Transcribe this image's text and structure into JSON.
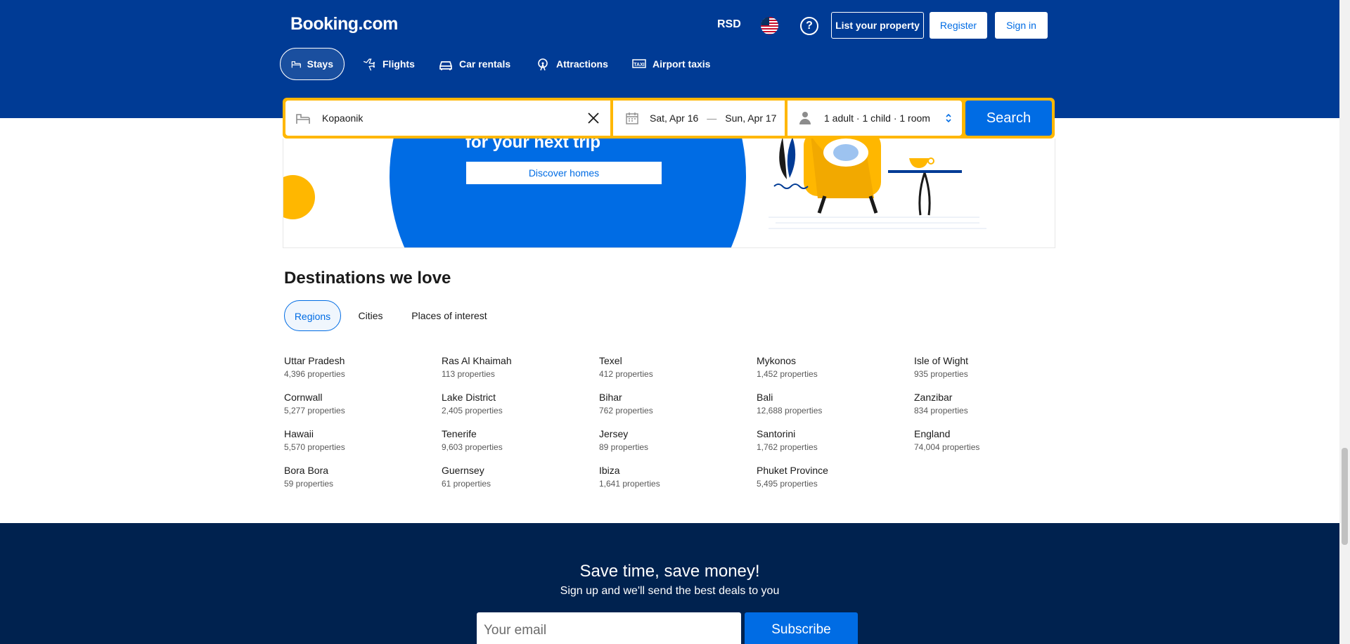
{
  "header": {
    "logo": "Booking.com",
    "currency": "RSD",
    "help_icon": "?",
    "list_property": "List your property",
    "register": "Register",
    "sign_in": "Sign in"
  },
  "nav": [
    {
      "label": "Stays",
      "icon": "bed-icon",
      "active": true
    },
    {
      "label": "Flights",
      "icon": "plane-icon"
    },
    {
      "label": "Car rentals",
      "icon": "car-icon"
    },
    {
      "label": "Attractions",
      "icon": "ferris-wheel-icon"
    },
    {
      "label": "Airport taxis",
      "icon": "taxi-icon"
    }
  ],
  "search": {
    "destination": "Kopaonik",
    "checkin": "Sat, Apr 16",
    "date_separator": "—",
    "checkout": "Sun, Apr 17",
    "guests": "1 adult · 1 child · 1 room",
    "button": "Search"
  },
  "banner": {
    "heading": "for your next trip",
    "button": "Discover homes"
  },
  "destinations": {
    "title": "Destinations we love",
    "tabs": [
      "Regions",
      "Cities",
      "Places of interest"
    ],
    "active_tab": "Regions",
    "columns": [
      [
        {
          "name": "Uttar Pradesh",
          "count": "4,396 properties"
        },
        {
          "name": "Cornwall",
          "count": "5,277 properties"
        },
        {
          "name": "Hawaii",
          "count": "5,570 properties"
        },
        {
          "name": "Bora Bora",
          "count": "59 properties"
        }
      ],
      [
        {
          "name": "Ras Al Khaimah",
          "count": "113 properties"
        },
        {
          "name": "Lake District",
          "count": "2,405 properties"
        },
        {
          "name": "Tenerife",
          "count": "9,603 properties"
        },
        {
          "name": "Guernsey",
          "count": "61 properties"
        }
      ],
      [
        {
          "name": "Texel",
          "count": "412 properties"
        },
        {
          "name": "Bihar",
          "count": "762 properties"
        },
        {
          "name": "Jersey",
          "count": "89 properties"
        },
        {
          "name": "Ibiza",
          "count": "1,641 properties"
        }
      ],
      [
        {
          "name": "Mykonos",
          "count": "1,452 properties"
        },
        {
          "name": "Bali",
          "count": "12,688 properties"
        },
        {
          "name": "Santorini",
          "count": "1,762 properties"
        },
        {
          "name": "Phuket Province",
          "count": "5,495 properties"
        }
      ],
      [
        {
          "name": "Isle of Wight",
          "count": "935 properties"
        },
        {
          "name": "Zanzibar",
          "count": "834 properties"
        },
        {
          "name": "England",
          "count": "74,004 properties"
        }
      ]
    ]
  },
  "footer": {
    "title": "Save time, save money!",
    "subtitle": "Sign up and we'll send the best deals to you",
    "email_placeholder": "Your email",
    "subscribe": "Subscribe"
  },
  "colors": {
    "brand_blue": "#003b95",
    "accent_blue": "#006ce4",
    "yellow": "#ffb700",
    "footer_navy": "#00224f"
  }
}
